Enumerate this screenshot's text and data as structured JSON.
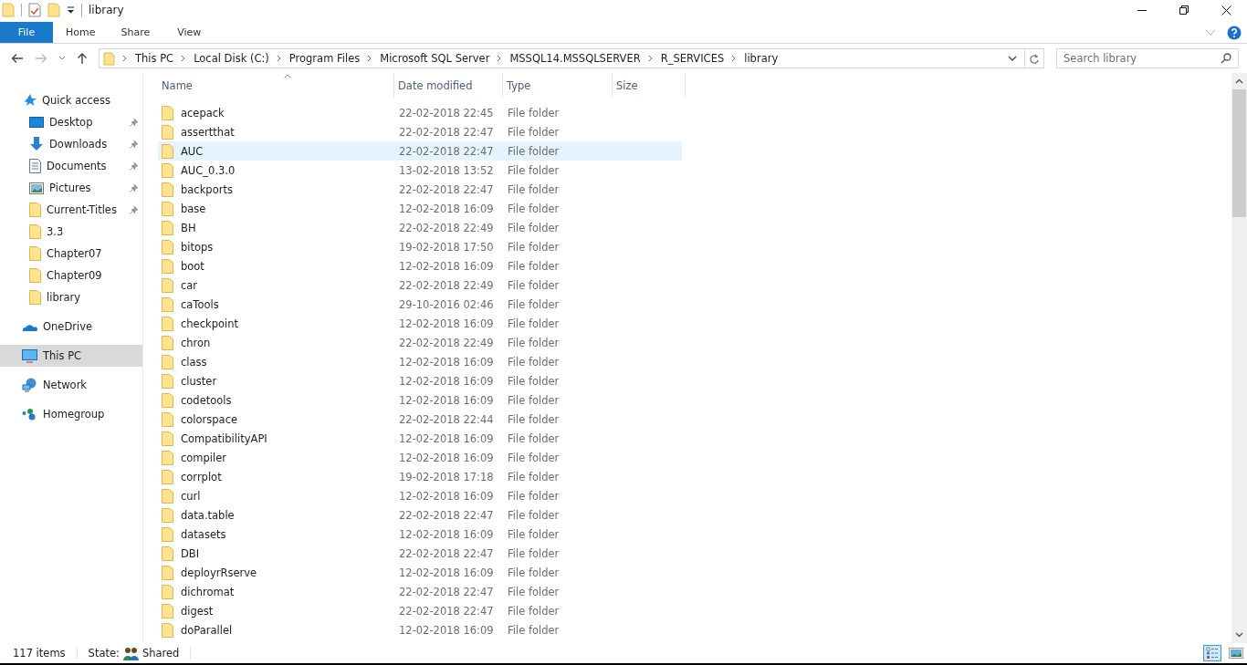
{
  "window": {
    "title": "library"
  },
  "ribbon": {
    "tabs": [
      {
        "label": "File",
        "selected": true
      },
      {
        "label": "Home",
        "selected": false
      },
      {
        "label": "Share",
        "selected": false
      },
      {
        "label": "View",
        "selected": false
      }
    ]
  },
  "address": {
    "crumbs": [
      "This PC",
      "Local Disk (C:)",
      "Program Files",
      "Microsoft SQL Server",
      "MSSQL14.MSSQLSERVER",
      "R_SERVICES",
      "library"
    ]
  },
  "search": {
    "placeholder": "Search library"
  },
  "sidebar": {
    "items": [
      {
        "label": "Quick access",
        "kind": "star",
        "selected": false,
        "children": [
          {
            "label": "Desktop",
            "kind": "desktop",
            "pinned": true
          },
          {
            "label": "Downloads",
            "kind": "downloads",
            "pinned": true
          },
          {
            "label": "Documents",
            "kind": "documents",
            "pinned": true
          },
          {
            "label": "Pictures",
            "kind": "pictures",
            "pinned": true
          },
          {
            "label": "Current-Titles",
            "kind": "folder",
            "pinned": true
          },
          {
            "label": "3.3",
            "kind": "folder",
            "pinned": false
          },
          {
            "label": "Chapter07",
            "kind": "folder",
            "pinned": false
          },
          {
            "label": "Chapter09",
            "kind": "folder",
            "pinned": false
          },
          {
            "label": "library",
            "kind": "folder",
            "pinned": false
          }
        ]
      },
      {
        "label": "OneDrive",
        "kind": "cloud",
        "selected": false
      },
      {
        "label": "This PC",
        "kind": "pc",
        "selected": true
      },
      {
        "label": "Network",
        "kind": "network",
        "selected": false
      },
      {
        "label": "Homegroup",
        "kind": "homegroup",
        "selected": false
      }
    ]
  },
  "table": {
    "columns": [
      "Name",
      "Date modified",
      "Type",
      "Size"
    ],
    "rows": [
      {
        "name": "acepack",
        "date": "22-02-2018 22:45",
        "type": "File folder",
        "selected": false
      },
      {
        "name": "assertthat",
        "date": "22-02-2018 22:47",
        "type": "File folder",
        "selected": false
      },
      {
        "name": "AUC",
        "date": "22-02-2018 22:47",
        "type": "File folder",
        "selected": true
      },
      {
        "name": "AUC_0.3.0",
        "date": "13-02-2018 13:52",
        "type": "File folder",
        "selected": false
      },
      {
        "name": "backports",
        "date": "22-02-2018 22:47",
        "type": "File folder",
        "selected": false
      },
      {
        "name": "base",
        "date": "12-02-2018 16:09",
        "type": "File folder",
        "selected": false
      },
      {
        "name": "BH",
        "date": "22-02-2018 22:49",
        "type": "File folder",
        "selected": false
      },
      {
        "name": "bitops",
        "date": "19-02-2018 17:50",
        "type": "File folder",
        "selected": false
      },
      {
        "name": "boot",
        "date": "12-02-2018 16:09",
        "type": "File folder",
        "selected": false
      },
      {
        "name": "car",
        "date": "22-02-2018 22:49",
        "type": "File folder",
        "selected": false
      },
      {
        "name": "caTools",
        "date": "29-10-2016 02:46",
        "type": "File folder",
        "selected": false
      },
      {
        "name": "checkpoint",
        "date": "12-02-2018 16:09",
        "type": "File folder",
        "selected": false
      },
      {
        "name": "chron",
        "date": "22-02-2018 22:49",
        "type": "File folder",
        "selected": false
      },
      {
        "name": "class",
        "date": "12-02-2018 16:09",
        "type": "File folder",
        "selected": false
      },
      {
        "name": "cluster",
        "date": "12-02-2018 16:09",
        "type": "File folder",
        "selected": false
      },
      {
        "name": "codetools",
        "date": "12-02-2018 16:09",
        "type": "File folder",
        "selected": false
      },
      {
        "name": "colorspace",
        "date": "22-02-2018 22:44",
        "type": "File folder",
        "selected": false
      },
      {
        "name": "CompatibilityAPI",
        "date": "12-02-2018 16:09",
        "type": "File folder",
        "selected": false
      },
      {
        "name": "compiler",
        "date": "12-02-2018 16:09",
        "type": "File folder",
        "selected": false
      },
      {
        "name": "corrplot",
        "date": "19-02-2018 17:18",
        "type": "File folder",
        "selected": false
      },
      {
        "name": "curl",
        "date": "12-02-2018 16:09",
        "type": "File folder",
        "selected": false
      },
      {
        "name": "data.table",
        "date": "22-02-2018 22:47",
        "type": "File folder",
        "selected": false
      },
      {
        "name": "datasets",
        "date": "12-02-2018 16:09",
        "type": "File folder",
        "selected": false
      },
      {
        "name": "DBI",
        "date": "22-02-2018 22:47",
        "type": "File folder",
        "selected": false
      },
      {
        "name": "deployrRserve",
        "date": "12-02-2018 16:09",
        "type": "File folder",
        "selected": false
      },
      {
        "name": "dichromat",
        "date": "22-02-2018 22:47",
        "type": "File folder",
        "selected": false
      },
      {
        "name": "digest",
        "date": "22-02-2018 22:47",
        "type": "File folder",
        "selected": false
      },
      {
        "name": "doParallel",
        "date": "12-02-2018 16:09",
        "type": "File folder",
        "selected": false
      }
    ]
  },
  "status_bar": {
    "count": "117 items",
    "state_label": "State:",
    "state_value": "Shared",
    "views": [
      {
        "kind": "details",
        "selected": true
      },
      {
        "kind": "large-icons",
        "selected": false
      }
    ]
  }
}
